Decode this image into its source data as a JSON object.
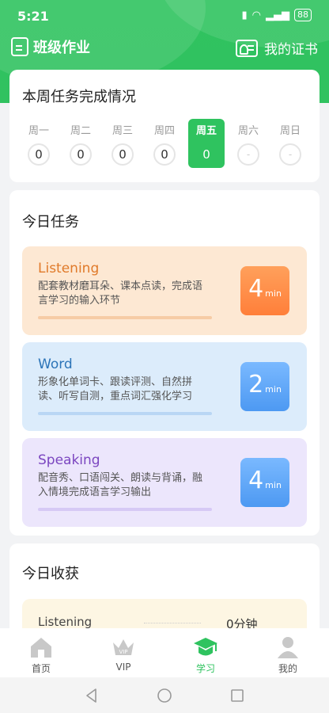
{
  "status_bar": {
    "time": "5:21",
    "battery": "88"
  },
  "topbar": {
    "title": "班级作业",
    "certificate_label": "我的证书"
  },
  "weekly": {
    "title": "本周任务完成情况",
    "days": [
      {
        "name": "周一",
        "count": "0"
      },
      {
        "name": "周二",
        "count": "0"
      },
      {
        "name": "周三",
        "count": "0"
      },
      {
        "name": "周四",
        "count": "0"
      },
      {
        "name": "周五",
        "count": "0"
      },
      {
        "name": "周六",
        "count": "-"
      },
      {
        "name": "周日",
        "count": "-"
      }
    ]
  },
  "today_tasks": {
    "title": "今日任务",
    "tasks": [
      {
        "name": "Listening",
        "desc": "配套教材磨耳朵、课本点读，完成语言学习的输入环节",
        "minutes": "4",
        "unit": "min"
      },
      {
        "name": "Word",
        "desc": "形象化单词卡、跟读评测、自然拼读、听写自测，重点词汇强化学习",
        "minutes": "2",
        "unit": "min"
      },
      {
        "name": "Speaking",
        "desc": "配音秀、口语闯关、朗读与背诵，融入情境完成语言学习输出",
        "minutes": "4",
        "unit": "min"
      }
    ]
  },
  "harvest": {
    "title": "今日收获",
    "rows": [
      {
        "name": "Listening",
        "value": "0分钟"
      }
    ]
  },
  "tabbar": {
    "tabs": [
      {
        "label": "首页"
      },
      {
        "label": "VIP"
      },
      {
        "label": "学习"
      },
      {
        "label": "我的"
      }
    ]
  },
  "colors": {
    "brand_green": "#2fc35f",
    "listening_bg": "#fde8d3",
    "word_bg": "#dcecfb",
    "speaking_bg": "#ece6fc"
  }
}
